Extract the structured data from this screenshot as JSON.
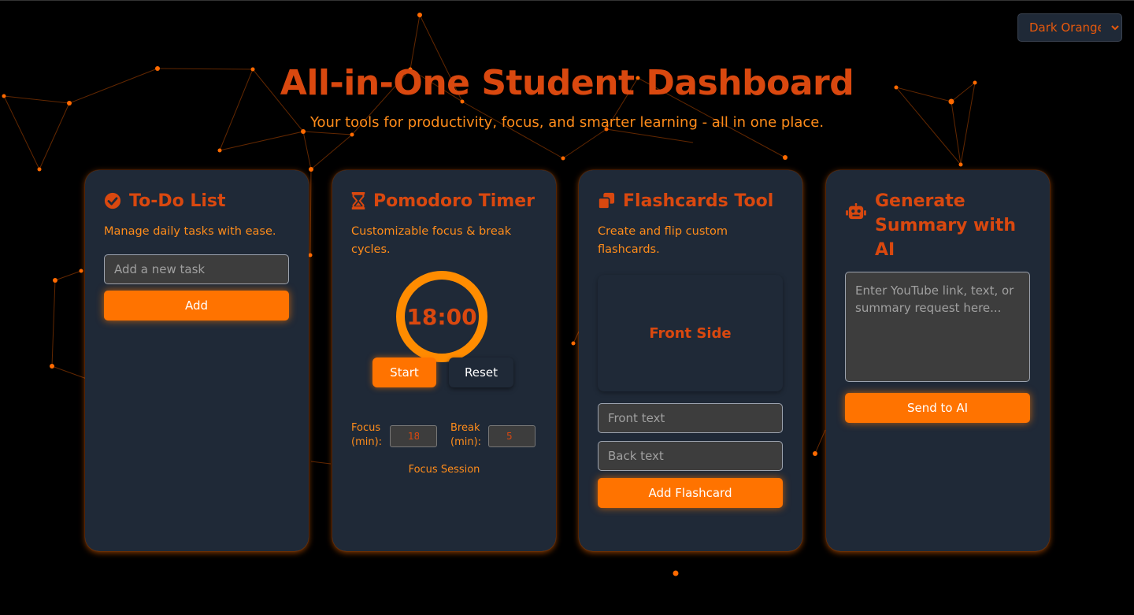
{
  "theme_select": {
    "selected": "Dark Orange"
  },
  "header": {
    "title": "All-in-One Student Dashboard",
    "subtitle": "Your tools for productivity, focus, and smarter learning - all in one place."
  },
  "todo": {
    "icon": "check-circle-icon",
    "title": "To-Do List",
    "description": "Manage daily tasks with ease.",
    "input_placeholder": "Add a new task",
    "add_label": "Add"
  },
  "pomodoro": {
    "icon": "hourglass-icon",
    "title": "Pomodoro Timer",
    "description": "Customizable focus & break cycles.",
    "time": "18:00",
    "start_label": "Start",
    "reset_label": "Reset",
    "focus_label": "Focus (min):",
    "focus_value": "18",
    "break_label": "Break (min):",
    "break_value": "5",
    "session_label": "Focus Session"
  },
  "flashcards": {
    "icon": "copy-icon",
    "title": "Flashcards Tool",
    "description": "Create and flip custom flashcards.",
    "card_text": "Front Side",
    "front_placeholder": "Front text",
    "back_placeholder": "Back text",
    "add_label": "Add Flashcard"
  },
  "ai": {
    "icon": "robot-icon",
    "title": "Generate Summary with AI",
    "textarea_placeholder": "Enter YouTube link, text, or summary request here...",
    "send_label": "Send to AI"
  },
  "colors": {
    "background": "#000000",
    "card": "#1f2937",
    "title": "#d9480f",
    "accent": "#ff7300",
    "text_accent": "#ff8c1a"
  }
}
